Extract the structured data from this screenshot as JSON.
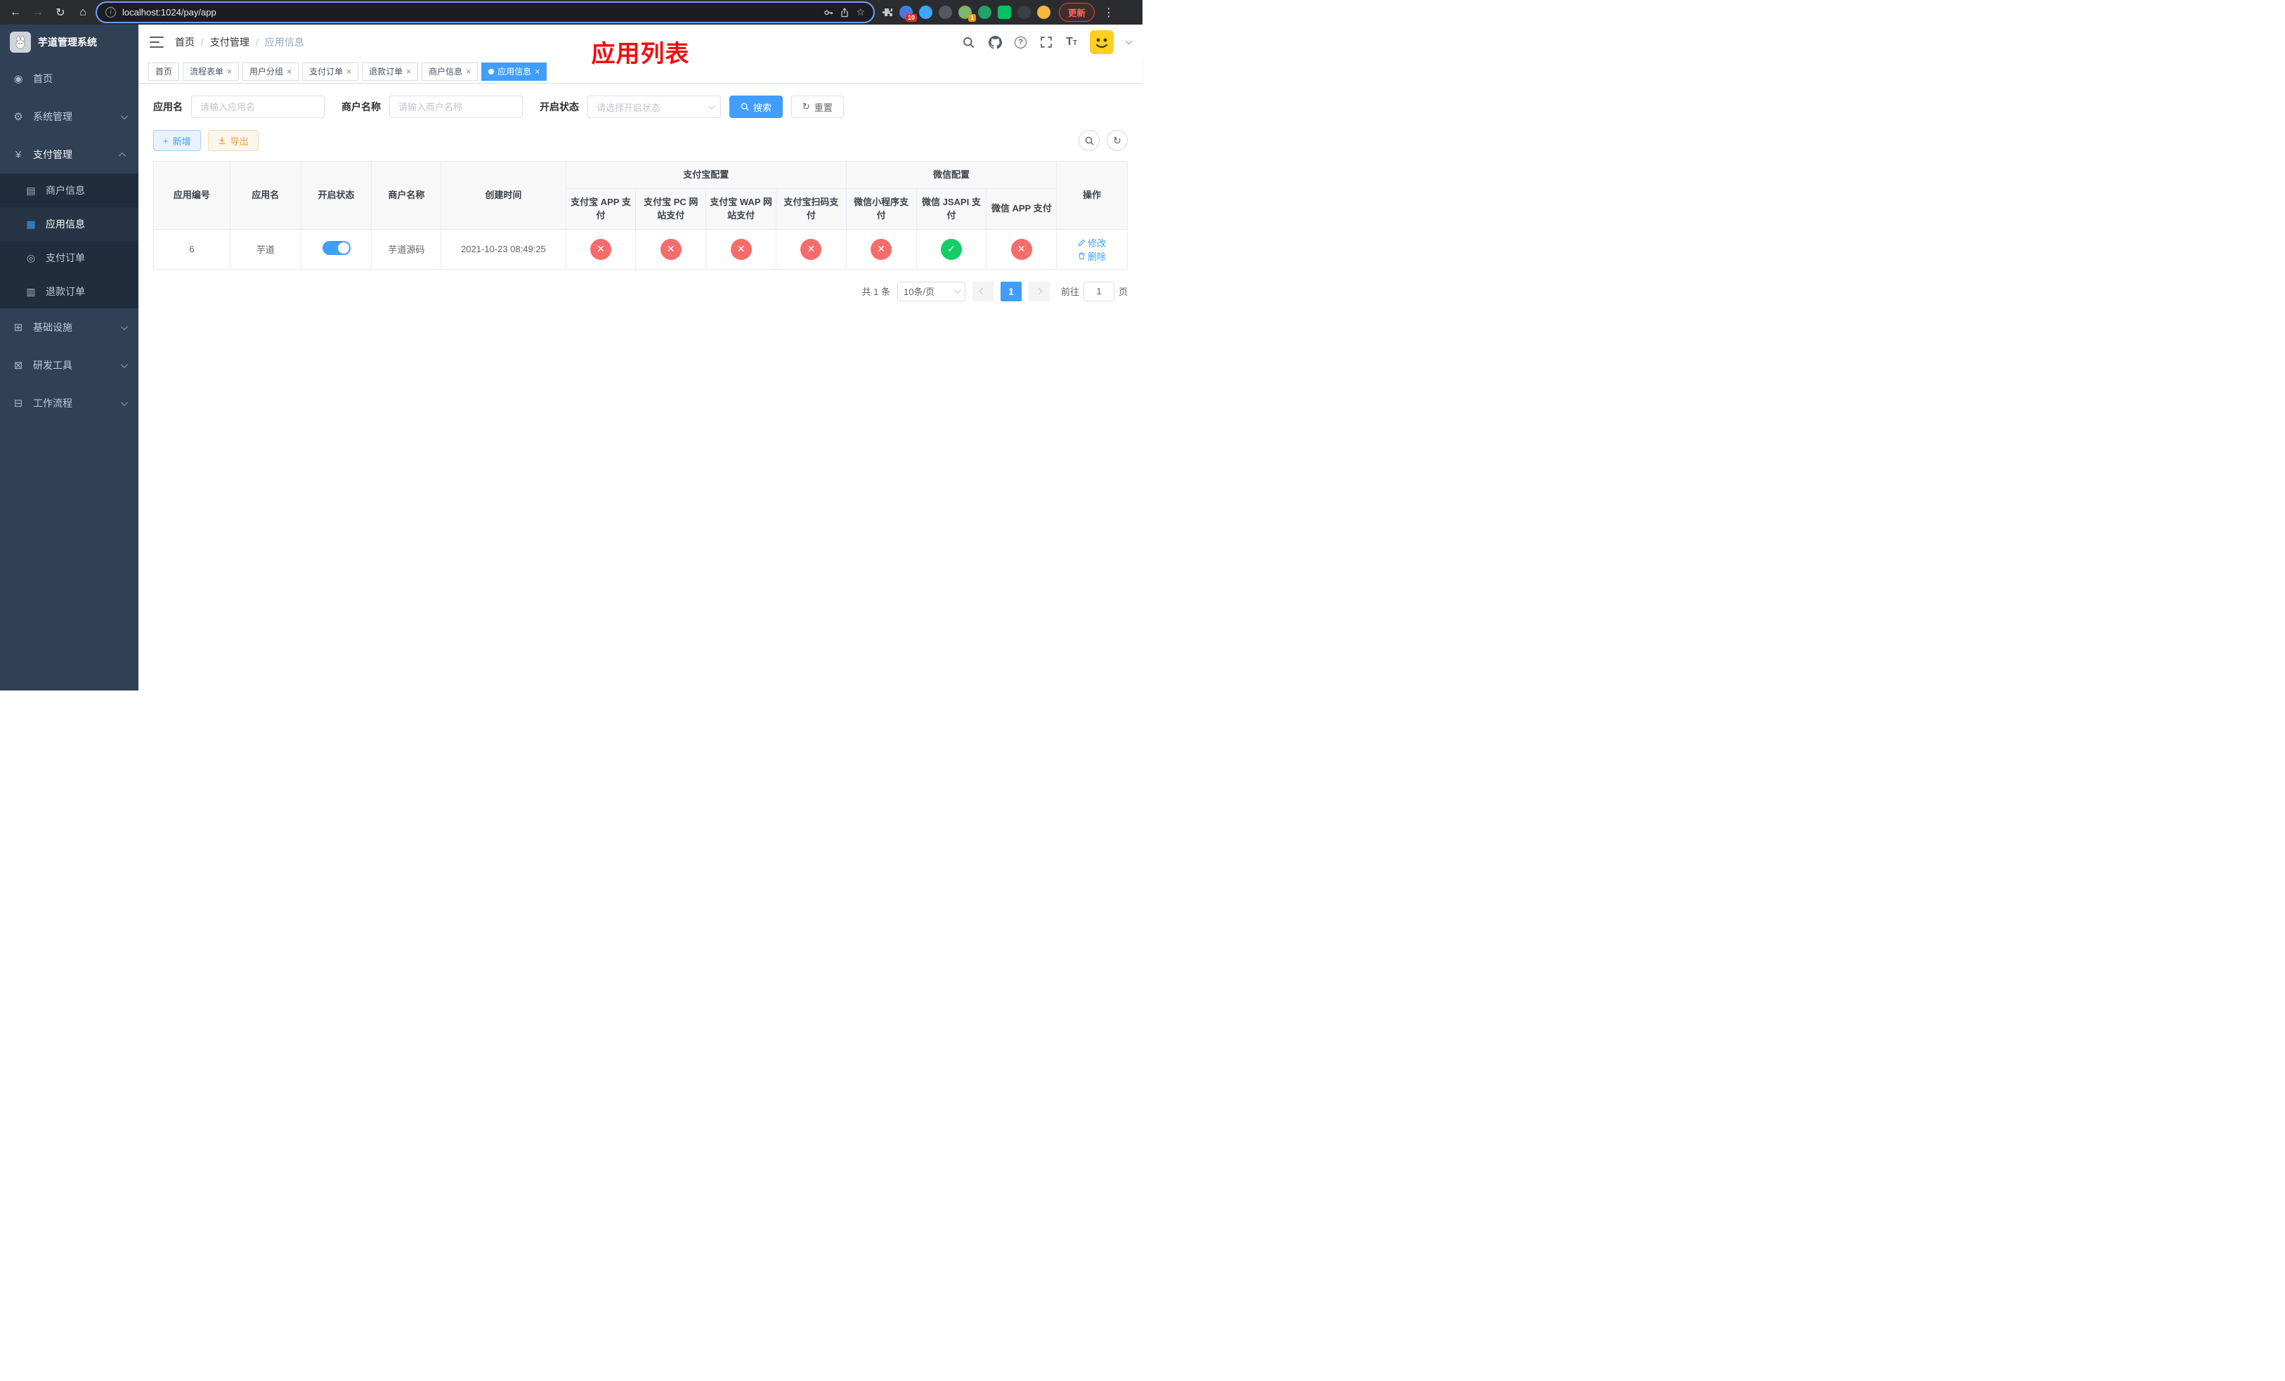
{
  "browser": {
    "url": "localhost:1024/pay/app",
    "update_button": "更新",
    "extension_badge_1": "10",
    "extension_badge_2": "1"
  },
  "sidebar": {
    "app_title": "芋道管理系统",
    "menu": [
      {
        "label": "首页"
      },
      {
        "label": "系统管理"
      },
      {
        "label": "支付管理"
      },
      {
        "label": "基础设施"
      },
      {
        "label": "研发工具"
      },
      {
        "label": "工作流程"
      }
    ],
    "payment_children": [
      {
        "label": "商户信息"
      },
      {
        "label": "应用信息"
      },
      {
        "label": "支付订单"
      },
      {
        "label": "退款订单"
      }
    ]
  },
  "header": {
    "breadcrumb": [
      {
        "label": "首页"
      },
      {
        "label": "支付管理"
      },
      {
        "label": "应用信息"
      }
    ],
    "page_title": "应用列表"
  },
  "tabs": [
    {
      "label": "首页"
    },
    {
      "label": "流程表单"
    },
    {
      "label": "用户分组"
    },
    {
      "label": "支付订单"
    },
    {
      "label": "退款订单"
    },
    {
      "label": "商户信息"
    },
    {
      "label": "应用信息"
    }
  ],
  "filters": {
    "app_name_label": "应用名",
    "app_name_placeholder": "请输入应用名",
    "merchant_label": "商户名称",
    "merchant_placeholder": "请输入商户名称",
    "status_label": "开启状态",
    "status_placeholder": "请选择开启状态",
    "search_button": "搜索",
    "reset_button": "重置"
  },
  "toolbar": {
    "add_button": "新增",
    "export_button": "导出"
  },
  "table": {
    "headers": {
      "app_id": "应用编号",
      "app_name": "应用名",
      "status": "开启状态",
      "merchant": "商户名称",
      "created": "创建时间",
      "alipay_group": "支付宝配置",
      "wechat_group": "微信配置",
      "alipay_app": "支付宝 APP 支付",
      "alipay_pc": "支付宝 PC 网站支付",
      "alipay_wap": "支付宝 WAP 网站支付",
      "alipay_qr": "支付宝扫码支付",
      "wechat_lite": "微信小程序支付",
      "wechat_jsapi": "微信 JSAPI 支付",
      "wechat_app": "微信 APP 支付",
      "actions": "操作"
    },
    "rows": [
      {
        "app_id": "6",
        "app_name": "芋道",
        "status_enabled": true,
        "merchant": "芋道源码",
        "created": "2021-10-23 08:49:25",
        "alipay_app": "disabled",
        "alipay_pc": "disabled",
        "alipay_wap": "disabled",
        "alipay_qr": "disabled",
        "wechat_lite": "disabled",
        "wechat_jsapi": "enabled",
        "wechat_app": "disabled",
        "edit_label": "修改",
        "delete_label": "删除"
      }
    ]
  },
  "pagination": {
    "total_text": "共 1 条",
    "page_size_text": "10条/页",
    "current_page": "1",
    "goto_prefix": "前往",
    "goto_value": "1",
    "goto_suffix": "页"
  },
  "colors": {
    "primary": "#409eff",
    "success": "#13ce66",
    "danger": "#f56c6c",
    "warning": "#e6a23c",
    "title_red": "#f20d0d",
    "sidebar_bg": "#304156",
    "submenu_bg": "#1f2d3d"
  }
}
